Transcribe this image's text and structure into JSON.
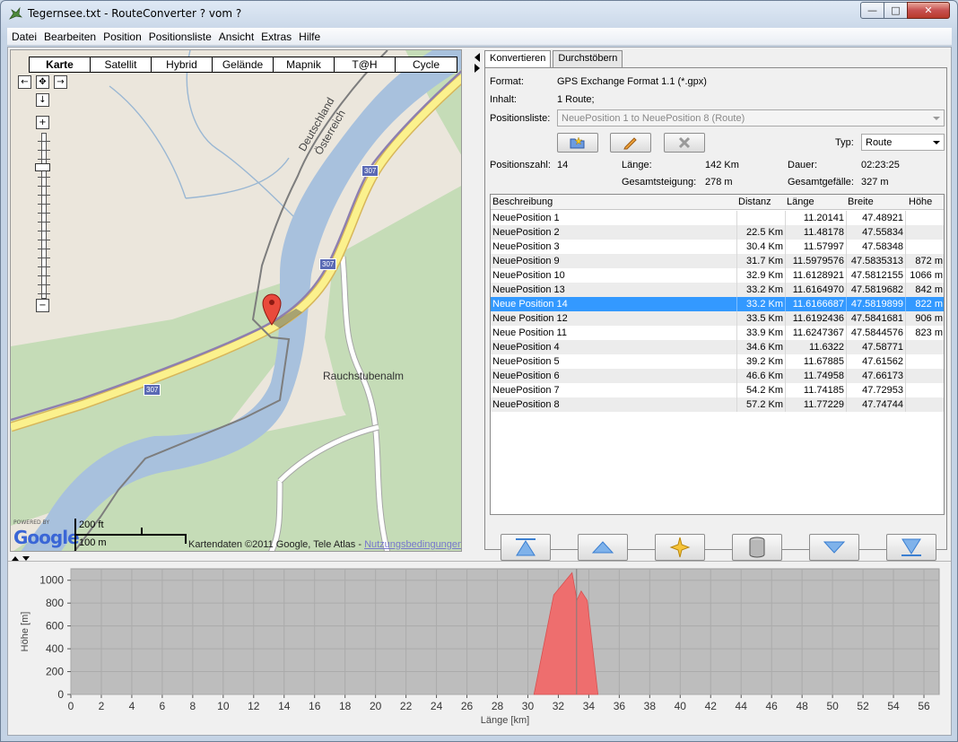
{
  "window": {
    "title": "Tegernsee.txt - RouteConverter ? vom ?",
    "min_glyph": "—",
    "max_glyph": "□",
    "close_glyph": "✕"
  },
  "menu": [
    "Datei",
    "Bearbeiten",
    "Position",
    "Positionsliste",
    "Ansicht",
    "Extras",
    "Hilfe"
  ],
  "map": {
    "map_types": [
      "Karte",
      "Satellit",
      "Hybrid",
      "Gelände",
      "Mapnik",
      "T@H",
      "Cycle"
    ],
    "active_map_type": "Karte",
    "labels": {
      "border_de": "Deutschland",
      "border_at": "Österreich",
      "place": "Rauchstubenalm"
    },
    "route_signs": [
      "307",
      "307",
      "307"
    ],
    "powered_by": "POWERED BY",
    "google": "Google",
    "scale_ft": "200 ft",
    "scale_m": "100 m",
    "copyright": "Kartendaten ©2011 Google, Tele Atlas - ",
    "terms_link": "Nutzungsbedingungen"
  },
  "panel": {
    "tabs": [
      "Konvertieren",
      "Durchstöbern"
    ],
    "active_tab": "Konvertieren",
    "format_label": "Format:",
    "format_value": "GPS Exchange Format 1.1 (*.gpx)",
    "content_label": "Inhalt:",
    "content_value": "1 Route;",
    "poslist_label": "Positionsliste:",
    "poslist_value": "NeuePosition 1 to NeuePosition 8 (Route)",
    "type_label": "Typ:",
    "type_value": "Route",
    "count_label": "Positionszahl:",
    "count_value": "14",
    "length_label": "Länge:",
    "length_value": "142 Km",
    "duration_label": "Dauer:",
    "duration_value": "02:23:25",
    "ascent_label": "Gesamtsteigung:",
    "ascent_value": "278 m",
    "descent_label": "Gesamtgefälle:",
    "descent_value": "327 m"
  },
  "table": {
    "columns": [
      "Beschreibung",
      "Distanz",
      "Länge",
      "Breite",
      "Höhe"
    ],
    "selected_row": 6,
    "rows": [
      {
        "desc": "NeuePosition 1",
        "dist": "",
        "lon": "11.20141",
        "lat": "47.48921",
        "ele": ""
      },
      {
        "desc": "NeuePosition 2",
        "dist": "22.5 Km",
        "lon": "11.48178",
        "lat": "47.55834",
        "ele": ""
      },
      {
        "desc": "NeuePosition 3",
        "dist": "30.4 Km",
        "lon": "11.57997",
        "lat": "47.58348",
        "ele": ""
      },
      {
        "desc": "NeuePosition 9",
        "dist": "31.7 Km",
        "lon": "11.5979576",
        "lat": "47.5835313",
        "ele": "872 m"
      },
      {
        "desc": "NeuePosition 10",
        "dist": "32.9 Km",
        "lon": "11.6128921",
        "lat": "47.5812155",
        "ele": "1066 m"
      },
      {
        "desc": "NeuePosition 13",
        "dist": "33.2 Km",
        "lon": "11.6164970",
        "lat": "47.5819682",
        "ele": "842 m"
      },
      {
        "desc": "Neue Position 14",
        "dist": "33.2 Km",
        "lon": "11.6166687",
        "lat": "47.5819899",
        "ele": "822 m"
      },
      {
        "desc": "Neue Position 12",
        "dist": "33.5 Km",
        "lon": "11.6192436",
        "lat": "47.5841681",
        "ele": "906 m"
      },
      {
        "desc": "Neue Position 11",
        "dist": "33.9 Km",
        "lon": "11.6247367",
        "lat": "47.5844576",
        "ele": "823 m"
      },
      {
        "desc": "NeuePosition 4",
        "dist": "34.6 Km",
        "lon": "11.6322",
        "lat": "47.58771",
        "ele": ""
      },
      {
        "desc": "NeuePosition 5",
        "dist": "39.2 Km",
        "lon": "11.67885",
        "lat": "47.61562",
        "ele": ""
      },
      {
        "desc": "NeuePosition 6",
        "dist": "46.6 Km",
        "lon": "11.74958",
        "lat": "47.66173",
        "ele": ""
      },
      {
        "desc": "NeuePosition 7",
        "dist": "54.2 Km",
        "lon": "11.74185",
        "lat": "47.72953",
        "ele": ""
      },
      {
        "desc": "NeuePosition 8",
        "dist": "57.2 Km",
        "lon": "11.77229",
        "lat": "47.74744",
        "ele": ""
      }
    ]
  },
  "chart_data": {
    "type": "area",
    "xlabel": "Länge [km]",
    "ylabel": "Höhe [m]",
    "xlim": [
      0,
      57
    ],
    "ylim": [
      0,
      1100
    ],
    "x_ticks": [
      0,
      2,
      4,
      6,
      8,
      10,
      12,
      14,
      16,
      18,
      20,
      22,
      24,
      26,
      28,
      30,
      32,
      34,
      36,
      38,
      40,
      42,
      44,
      46,
      48,
      50,
      52,
      54,
      56
    ],
    "y_ticks": [
      0,
      200,
      400,
      600,
      800,
      1000
    ],
    "grid": true,
    "series": [
      {
        "color": "#ee6e6e",
        "x": [
          30.4,
          31.7,
          32.9,
          33.2,
          33.2,
          33.5,
          33.9,
          34.6
        ],
        "y": [
          0,
          872,
          1066,
          842,
          822,
          906,
          823,
          0
        ]
      }
    ],
    "marker_x": 33.2
  }
}
